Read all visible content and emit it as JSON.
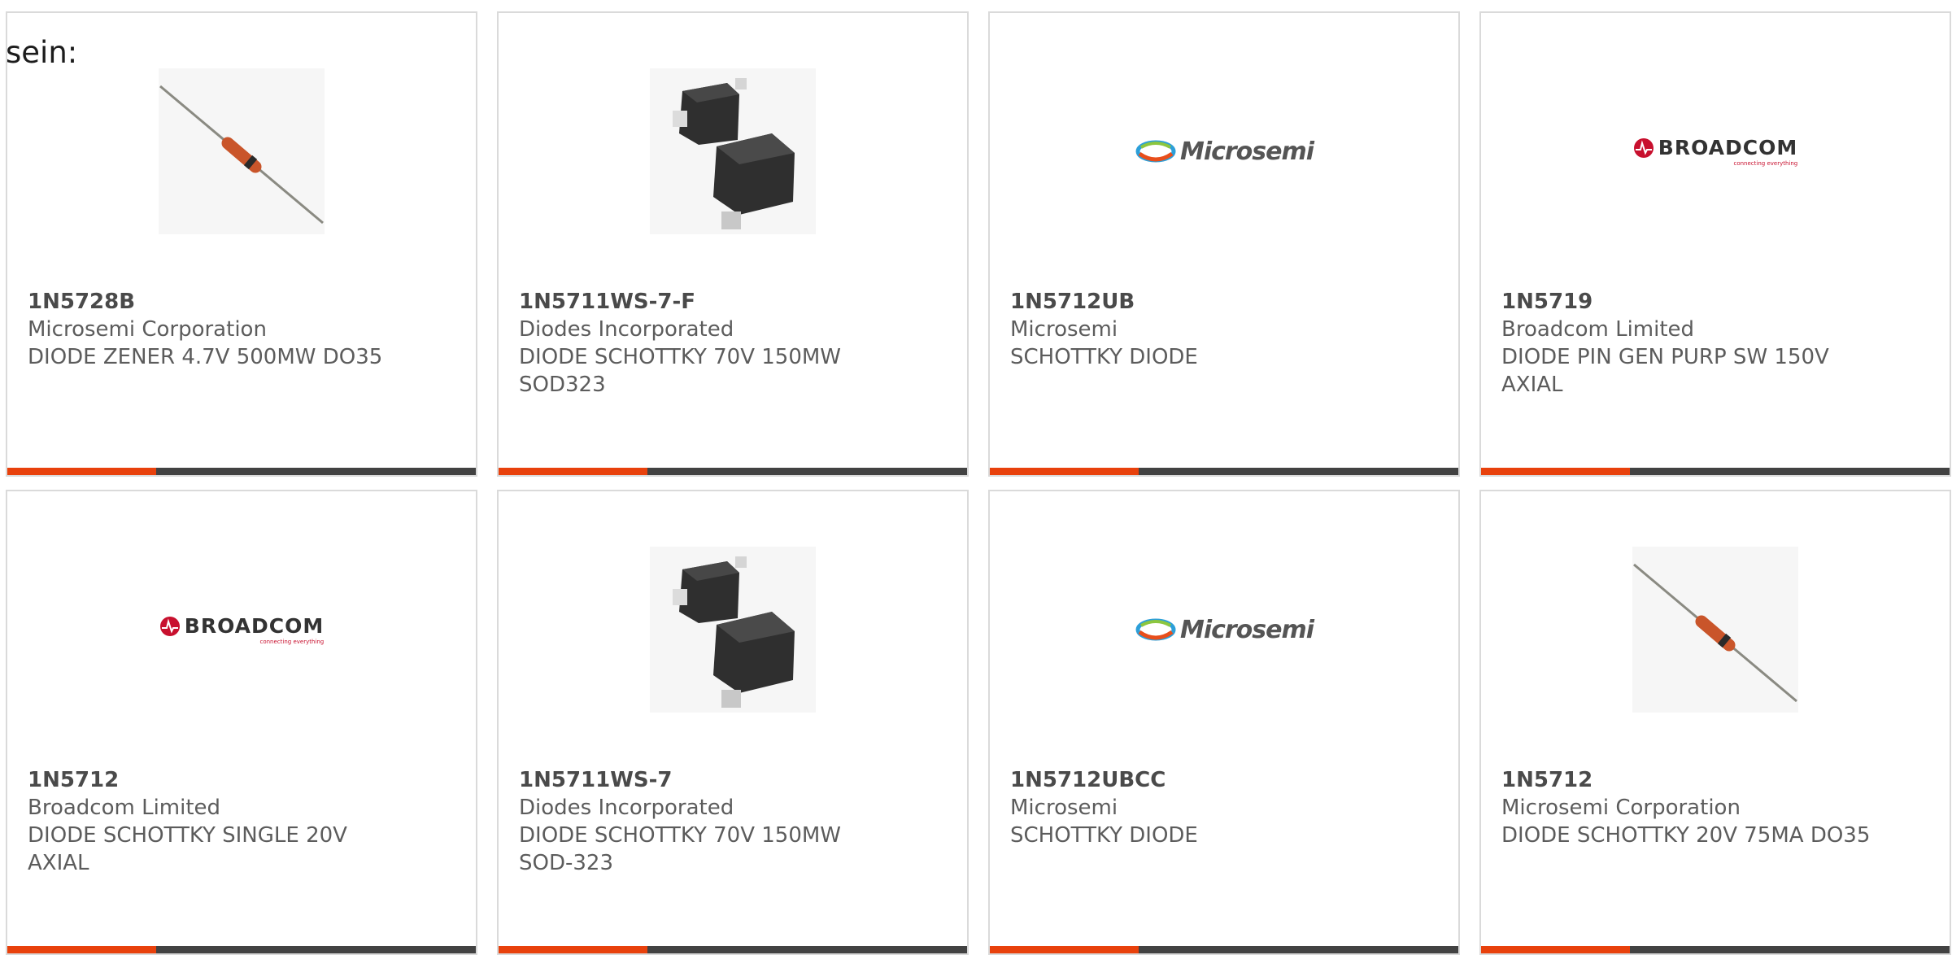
{
  "intro_text": "sein:",
  "colors": {
    "accent": "#e8410c",
    "bar": "#424242",
    "card_border": "#dadada",
    "text": "#5c5c5c",
    "broadcom_red": "#c8102e"
  },
  "logos": {
    "microsemi": "Microsemi",
    "broadcom": "BROADCOM",
    "broadcom_tagline": "connecting everything"
  },
  "products": [
    {
      "part_number": "1N5728B",
      "manufacturer": "Microsemi Corporation",
      "description": "DIODE ZENER 4.7V 500MW DO35",
      "image": "axial-diode-photo"
    },
    {
      "part_number": "1N5711WS-7-F",
      "manufacturer": "Diodes Incorporated",
      "description": "DIODE SCHOTTKY 70V 150MW SOD323",
      "image": "sod323-package-photo"
    },
    {
      "part_number": "1N5712UB",
      "manufacturer": "Microsemi",
      "description": "SCHOTTKY DIODE",
      "image": "microsemi-logo"
    },
    {
      "part_number": "1N5719",
      "manufacturer": "Broadcom Limited",
      "description": "DIODE PIN GEN PURP SW 150V AXIAL",
      "image": "broadcom-logo"
    },
    {
      "part_number": "1N5712",
      "manufacturer": "Broadcom Limited",
      "description": "DIODE SCHOTTKY SINGLE 20V AXIAL",
      "image": "broadcom-logo"
    },
    {
      "part_number": "1N5711WS-7",
      "manufacturer": "Diodes Incorporated",
      "description": "DIODE SCHOTTKY 70V 150MW SOD-323",
      "image": "sod323-package-photo"
    },
    {
      "part_number": "1N5712UBCC",
      "manufacturer": "Microsemi",
      "description": "SCHOTTKY DIODE",
      "image": "microsemi-logo"
    },
    {
      "part_number": "1N5712",
      "manufacturer": "Microsemi Corporation",
      "description": "DIODE SCHOTTKY 20V 75MA DO35",
      "image": "axial-diode-photo"
    }
  ]
}
